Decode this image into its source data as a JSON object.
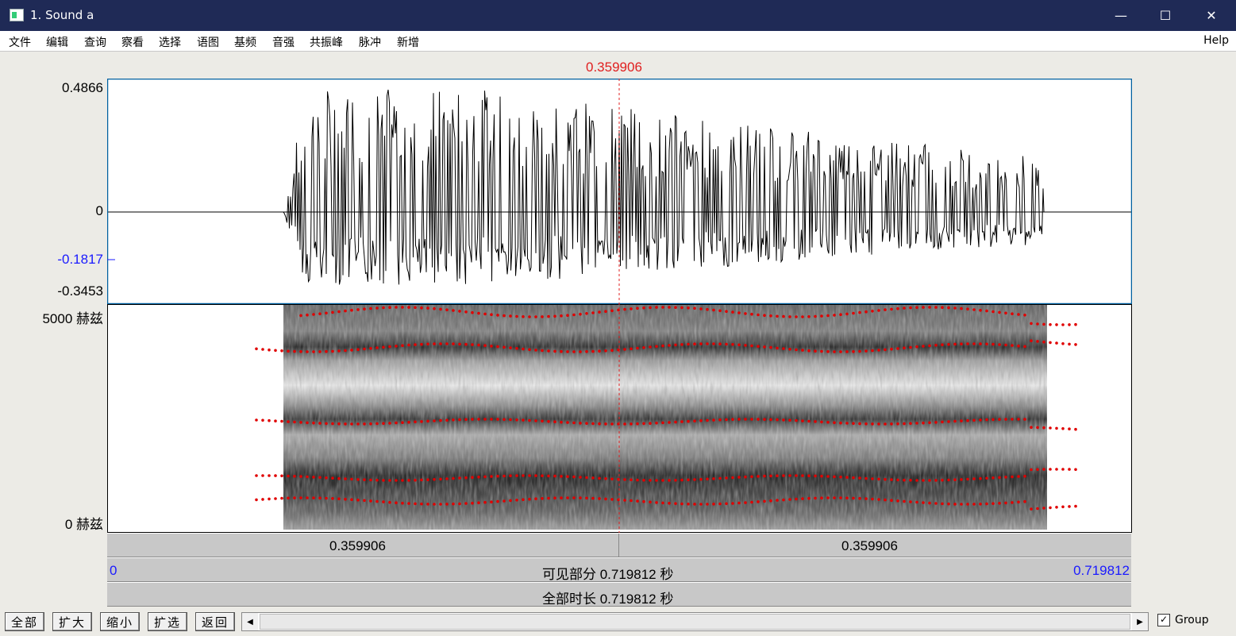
{
  "window": {
    "title": "1. Sound a",
    "minimize": "—",
    "maximize": "☐",
    "close": "✕"
  },
  "menu": {
    "items": [
      "文件",
      "编辑",
      "查询",
      "察看",
      "选择",
      "语图",
      "基频",
      "音强",
      "共振峰",
      "脉冲",
      "新增"
    ],
    "help": "Help"
  },
  "cursor_time": "0.359906",
  "waveform": {
    "y_max": "0.4866",
    "y_zero": "0",
    "y_cursor": "-0.1817",
    "y_min": "-0.3453"
  },
  "spectrogram": {
    "y_top": "5000 赫兹",
    "y_bottom": "0 赫兹"
  },
  "time_bars": {
    "left_segment": "0.359906",
    "right_segment": "0.359906",
    "visible_start": "0",
    "visible_label": "可见部分 0.719812 秒",
    "visible_end": "0.719812",
    "total_label": "全部时长 0.719812 秒"
  },
  "toolbar": {
    "all": "全部",
    "zoom_in": "扩大",
    "zoom_out": "缩小",
    "zoom_sel": "扩选",
    "back": "返回"
  },
  "group": {
    "label": "Group",
    "checked": true
  },
  "colors": {
    "titlebar": "#1f2a56",
    "cursor": "#e02020",
    "formant": "#e00000",
    "axis_blue": "#1a1aff",
    "frame": "#0060a0"
  }
}
